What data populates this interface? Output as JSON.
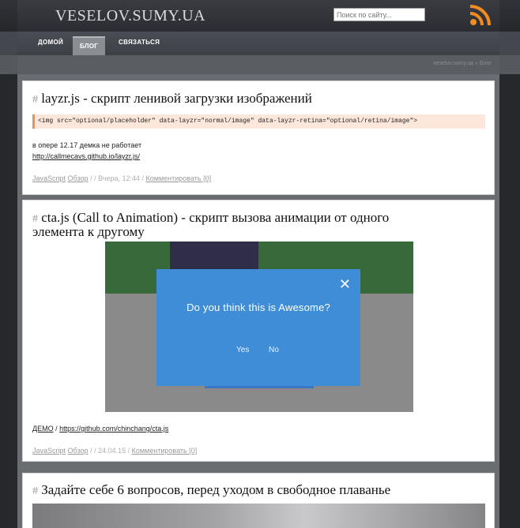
{
  "site": {
    "logo": "VESELOV.SUMY.UA",
    "search_placeholder": "Поиск по сайту..."
  },
  "nav": {
    "items": [
      "ДОМОЙ",
      "БЛОГ",
      "СВЯЗАТЬСЯ"
    ]
  },
  "breadcrumb": "veselov.sumy.ua » Блог",
  "posts": [
    {
      "hash": "#",
      "title": "layzr.js - скрипт ленивой загрузки изображений",
      "code": "<img src=\"optional/placeholder\" data-layzr=\"normal/image\" data-layzr-retina=\"optional/retina/image\">",
      "text": "в опере 12.17 демка не работает",
      "link": "http://callmecavs.github.io/layzr.js/",
      "meta": {
        "tag": "JavaScript",
        "category": "Обзор",
        "date": "/ / Вчера, 12:44 /",
        "comment": "Комментировать [0]"
      }
    },
    {
      "hash": "#",
      "title_line1": "cta.js (Call to Animation) - скрипт вызова анимации от одного",
      "title_line2": "элемента к другому",
      "demo": {
        "question": "Do you think this is Awesome?",
        "yes": "Yes",
        "no": "No",
        "close": "✕"
      },
      "demo_link": "ДЕМО",
      "sep": "/",
      "link": "https://github.com/chinchang/cta.js",
      "meta": {
        "tag": "JavaScript",
        "category": "Обзор",
        "date": "/ / 24.04.15 /",
        "comment": "Комментировать [0]"
      }
    },
    {
      "hash": "#",
      "title": "Задайте себе 6 вопросов, перед уходом в свободное плаванье"
    }
  ],
  "colors": {
    "accent_code_border": "#e8915a",
    "modal_blue": "#3f8dd6",
    "rss_orange": "#f28c1e"
  }
}
